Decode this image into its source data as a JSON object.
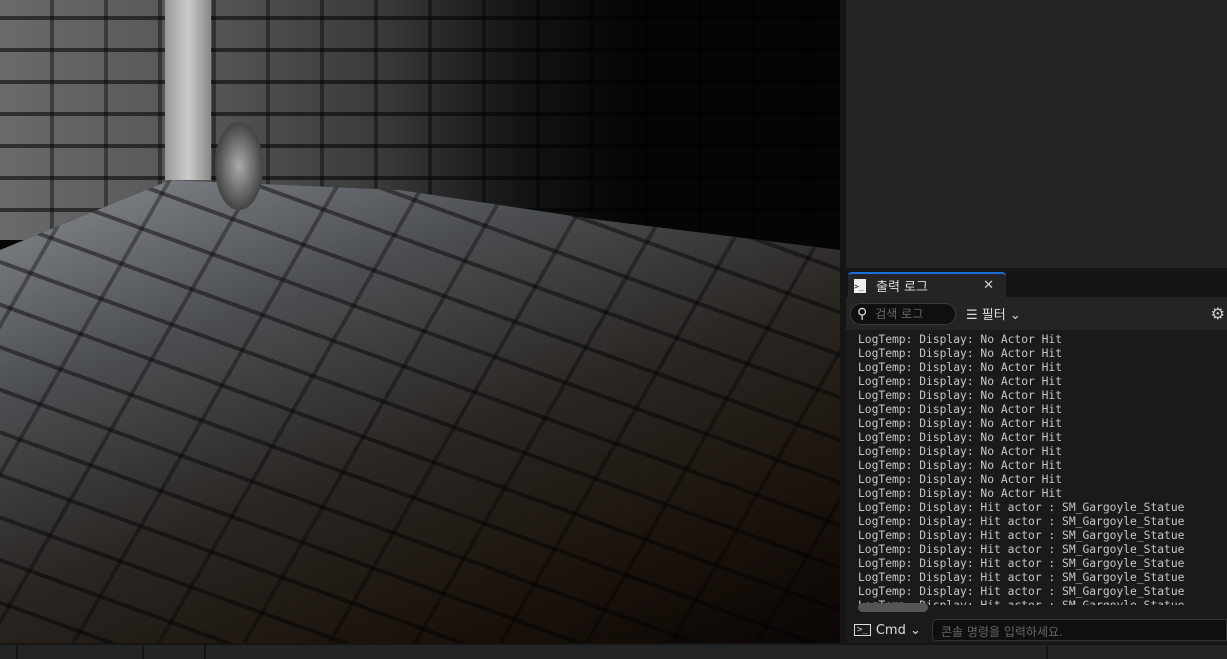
{
  "output_log": {
    "tab_label": "출력 로그",
    "search_placeholder": "검색 로그",
    "filter_label": "필터",
    "lines": [
      "LogTemp: Display: No Actor Hit",
      "LogTemp: Display: No Actor Hit",
      "LogTemp: Display: No Actor Hit",
      "LogTemp: Display: No Actor Hit",
      "LogTemp: Display: No Actor Hit",
      "LogTemp: Display: No Actor Hit",
      "LogTemp: Display: No Actor Hit",
      "LogTemp: Display: No Actor Hit",
      "LogTemp: Display: No Actor Hit",
      "LogTemp: Display: No Actor Hit",
      "LogTemp: Display: No Actor Hit",
      "LogTemp: Display: No Actor Hit",
      "LogTemp: Display: Hit actor : SM_Gargoyle_Statue",
      "LogTemp: Display: Hit actor : SM_Gargoyle_Statue",
      "LogTemp: Display: Hit actor : SM_Gargoyle_Statue",
      "LogTemp: Display: Hit actor : SM_Gargoyle_Statue",
      "LogTemp: Display: Hit actor : SM_Gargoyle_Statue",
      "LogTemp: Display: Hit actor : SM_Gargoyle_Statue",
      "LogTemp: Display: Hit actor : SM_Gargoyle_Statue",
      "LogTemp: Display: Hit actor : SM_Gargoyle_Statue"
    ],
    "cmd_label": "Cmd",
    "cmd_placeholder": "콘솔 명령을 입력하세요."
  },
  "colors": {
    "accent": "#1a6fd8",
    "panel": "#242424"
  }
}
